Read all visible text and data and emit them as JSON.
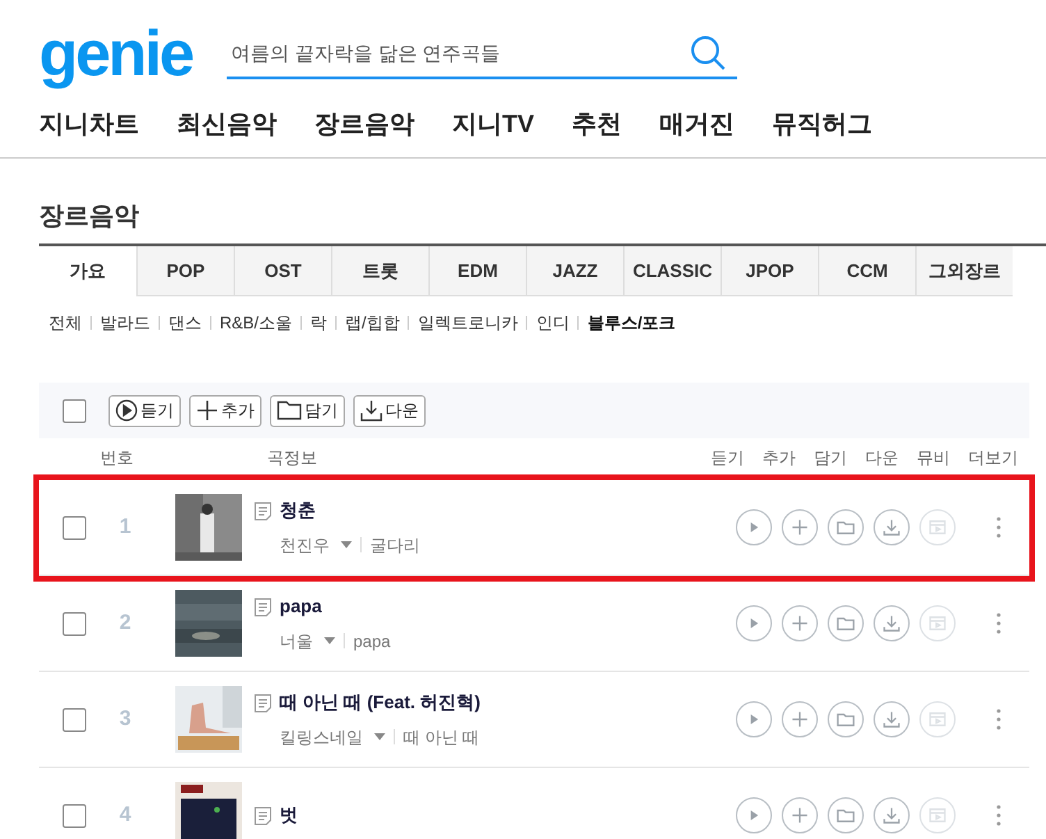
{
  "logo": "genie",
  "search": {
    "value": "여름의 끝자락을 닮은 연주곡들"
  },
  "nav": [
    "지니차트",
    "최신음악",
    "장르음악",
    "지니TV",
    "추천",
    "매거진",
    "뮤직허그"
  ],
  "page_title": "장르음악",
  "tabs": [
    {
      "label": "가요",
      "selected": true
    },
    {
      "label": "POP",
      "selected": false
    },
    {
      "label": "OST",
      "selected": false
    },
    {
      "label": "트롯",
      "selected": false
    },
    {
      "label": "EDM",
      "selected": false
    },
    {
      "label": "JAZZ",
      "selected": false
    },
    {
      "label": "CLASSIC",
      "selected": false
    },
    {
      "label": "JPOP",
      "selected": false
    },
    {
      "label": "CCM",
      "selected": false
    },
    {
      "label": "그외장르",
      "selected": false
    }
  ],
  "subgenres": [
    {
      "label": "전체",
      "selected": false
    },
    {
      "label": "발라드",
      "selected": false
    },
    {
      "label": "댄스",
      "selected": false
    },
    {
      "label": "R&B/소울",
      "selected": false
    },
    {
      "label": "락",
      "selected": false
    },
    {
      "label": "랩/힙합",
      "selected": false
    },
    {
      "label": "일렉트로니카",
      "selected": false
    },
    {
      "label": "인디",
      "selected": false
    },
    {
      "label": "블루스/포크",
      "selected": true
    }
  ],
  "toolbar": {
    "select_all_checked": false,
    "buttons": [
      "듣기",
      "추가",
      "담기",
      "다운"
    ]
  },
  "columns": {
    "number": "번호",
    "info": "곡정보",
    "actions": [
      "듣기",
      "추가",
      "담기",
      "다운",
      "뮤비",
      "더보기"
    ]
  },
  "songs": [
    {
      "number": "1",
      "title": "청춘",
      "artist": "천진우",
      "album": "굴다리",
      "checked": false,
      "highlighted": true
    },
    {
      "number": "2",
      "title": "papa",
      "artist": "너울",
      "album": "papa",
      "checked": false,
      "highlighted": false
    },
    {
      "number": "3",
      "title": "때 아닌 때 (Feat. 허진혁)",
      "artist": "킬링스네일",
      "album": "때 아닌 때",
      "checked": false,
      "highlighted": false
    },
    {
      "number": "4",
      "title": "벗",
      "checked": false,
      "highlighted": false
    }
  ]
}
